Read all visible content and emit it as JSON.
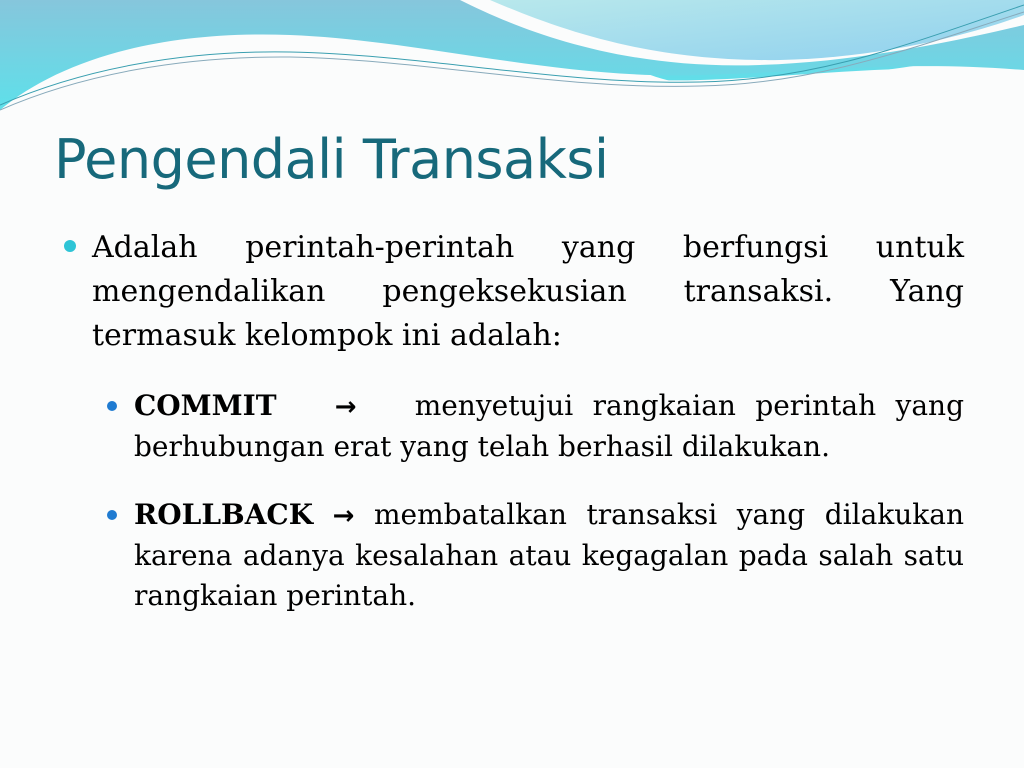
{
  "slide": {
    "title": "Pengendali Transaksi",
    "bullets": [
      {
        "text": "Adalah perintah-perintah yang berfungsi untuk mengendalikan pengeksekusian transaksi. Yang termasuk kelompok ini adalah:",
        "subitems": [
          {
            "keyword": "COMMIT",
            "arrow": "→",
            "text": "menyetujui rangkaian perintah yang berhubungan erat yang telah berhasil dilakukan."
          },
          {
            "keyword": "ROLLBACK",
            "arrow": "→",
            "text": "membatalkan transaksi yang dilakukan karena adanya kesalahan atau kegagalan pada salah satu rangkaian perintah."
          }
        ]
      }
    ],
    "colors": {
      "title": "#17697b",
      "bullet_l1": "#2ec4d6",
      "bullet_l2": "#1f7bd1"
    }
  }
}
